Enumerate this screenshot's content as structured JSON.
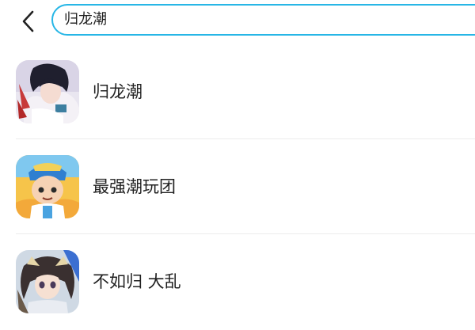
{
  "search": {
    "value": "归龙潮"
  },
  "results": [
    {
      "name": "归龙潮",
      "icon": "game-icon-guilongchao"
    },
    {
      "name": "最强潮玩团",
      "icon": "game-icon-zuiqiangchaowantuan"
    },
    {
      "name": "不如归 大乱",
      "icon": "game-icon-buruguidaluan"
    }
  ],
  "colors": {
    "accent": "#27b6e6",
    "text": "#222222",
    "divider": "#ececec"
  },
  "icons": {
    "back": "chevron-left-icon"
  }
}
